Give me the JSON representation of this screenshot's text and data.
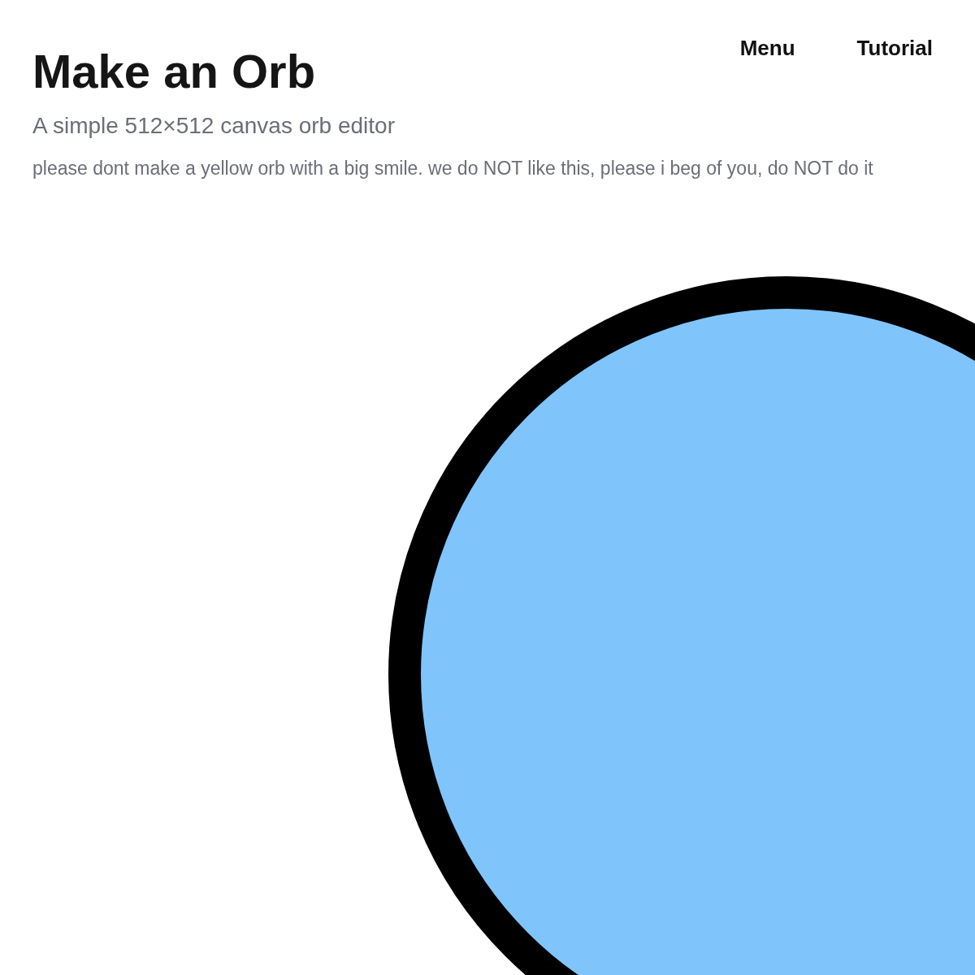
{
  "nav": [
    {
      "label": "Menu"
    },
    {
      "label": "Tutorial"
    }
  ],
  "title": "Make an Orb",
  "subtitle": "A simple 512×512 canvas orb editor",
  "warning": "please dont make a yellow orb with a big smile. we do NOT like this, please i beg of you, do NOT do it"
}
